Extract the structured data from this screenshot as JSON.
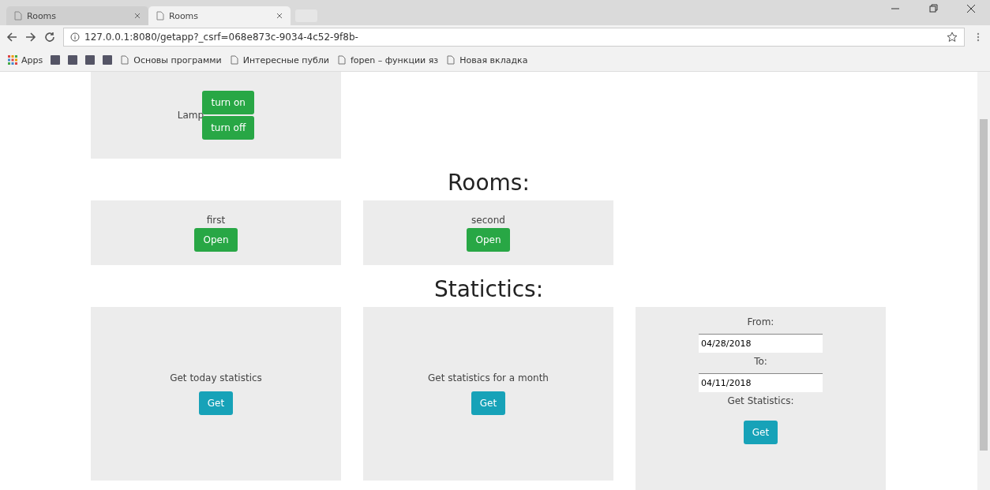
{
  "tabs": [
    {
      "label": "Rooms",
      "selected": false
    },
    {
      "label": "Rooms",
      "selected": true
    }
  ],
  "address": "127.0.0.1:8080/getapp?_csrf=068e873c-9034-4c52-9f8b-",
  "bookmarks": [
    {
      "label": "Apps",
      "kind": "apps"
    },
    {
      "kind": "icon"
    },
    {
      "kind": "icon"
    },
    {
      "kind": "icon"
    },
    {
      "kind": "icon"
    },
    {
      "label": "Основы программи",
      "kind": "page"
    },
    {
      "label": "Интересные публи",
      "kind": "page"
    },
    {
      "label": "fopen – функции яз",
      "kind": "page"
    },
    {
      "label": "Новая вкладка",
      "kind": "page"
    }
  ],
  "lamp": {
    "label": "Lamp",
    "buttons": [
      "turn on",
      "turn off"
    ]
  },
  "rooms_heading": "Rooms:",
  "rooms": [
    {
      "name": "first",
      "button": "Open"
    },
    {
      "name": "second",
      "button": "Open"
    }
  ],
  "stats_heading": "Statictics:",
  "stats": [
    {
      "kind": "simple",
      "label": "Get today statistics",
      "button": "Get"
    },
    {
      "kind": "simple",
      "label": "Get statistics for a month",
      "button": "Get"
    },
    {
      "kind": "range",
      "from_label": "From:",
      "from_value": "04/28/2018",
      "to_label": "To:",
      "to_value": "04/11/2018",
      "label": "Get Statistics:",
      "button": "Get"
    }
  ]
}
